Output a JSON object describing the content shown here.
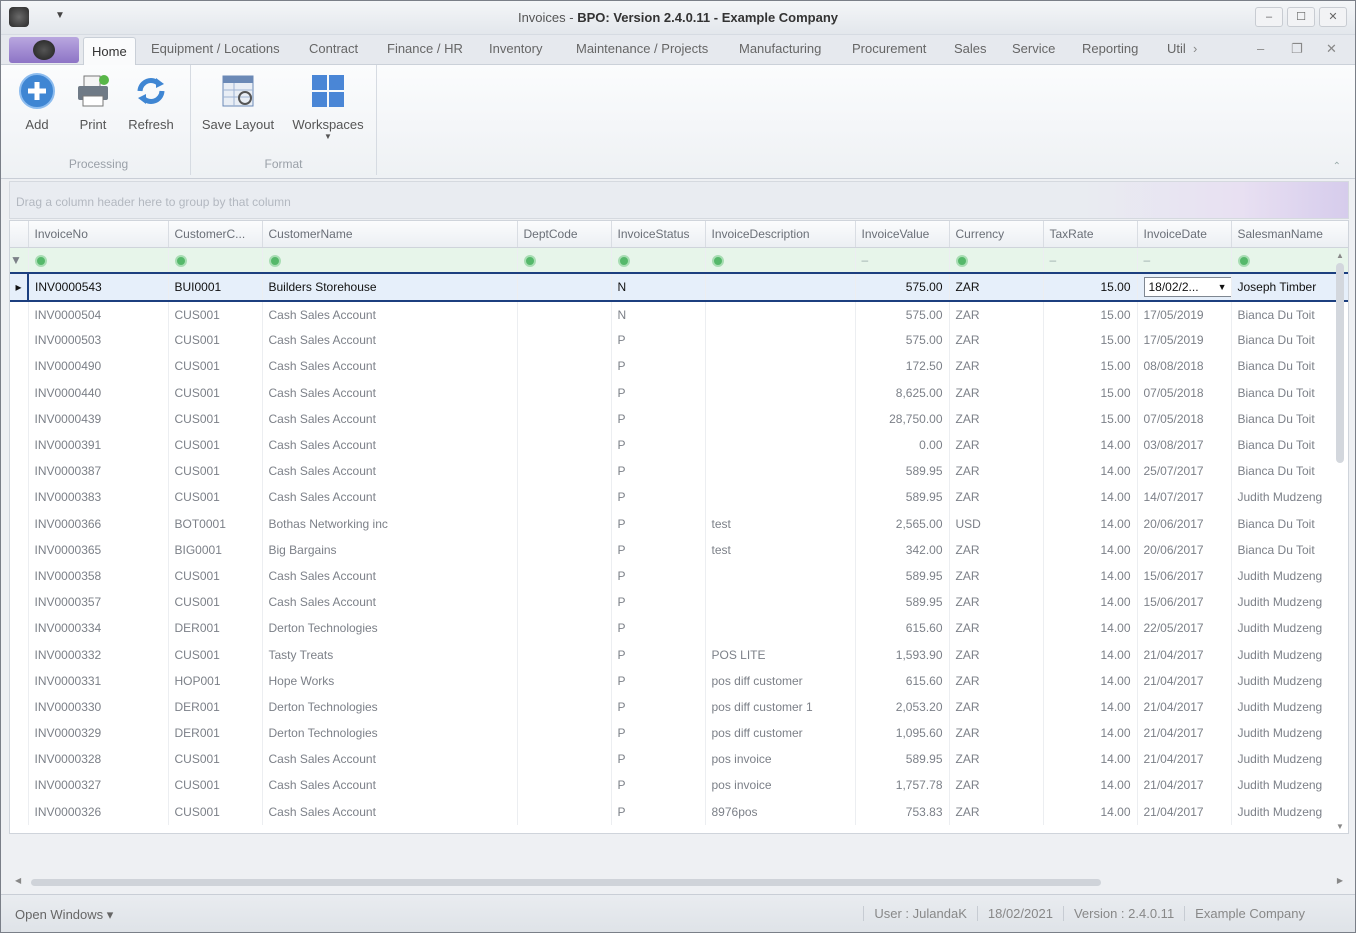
{
  "window": {
    "title_prefix": "Invoices - ",
    "title_bold": "BPO: Version 2.4.0.11 - Example Company",
    "controls": [
      "–",
      "☐",
      "✕"
    ]
  },
  "ribbon_tabs": [
    "Home",
    "Equipment / Locations",
    "Contract",
    "Finance / HR",
    "Inventory",
    "Maintenance / Projects",
    "Manufacturing",
    "Procurement",
    "Sales",
    "Service",
    "Reporting",
    "Util"
  ],
  "ribbon": {
    "processing": {
      "label": "Processing",
      "buttons": [
        "Add",
        "Print",
        "Refresh"
      ]
    },
    "format": {
      "label": "Format",
      "buttons": [
        "Save Layout",
        "Workspaces"
      ]
    }
  },
  "group_panel_hint": "Drag a column header here to group by that column",
  "columns": [
    "InvoiceNo",
    "CustomerC...",
    "CustomerName",
    "DeptCode",
    "InvoiceStatus",
    "InvoiceDescription",
    "InvoiceValue",
    "Currency",
    "TaxRate",
    "InvoiceDate",
    "SalesmanName"
  ],
  "selected_row": [
    "INV0000543",
    "BUI0001",
    "Builders Storehouse",
    "",
    "N",
    "",
    "575.00",
    "ZAR",
    "15.00",
    "18/02/2...",
    "Joseph Timber"
  ],
  "rows": [
    [
      "INV0000504",
      "CUS001",
      "Cash Sales Account",
      "",
      "N",
      "",
      "575.00",
      "ZAR",
      "15.00",
      "17/05/2019",
      "Bianca Du Toit"
    ],
    [
      "INV0000503",
      "CUS001",
      "Cash Sales Account",
      "",
      "P",
      "",
      "575.00",
      "ZAR",
      "15.00",
      "17/05/2019",
      "Bianca Du Toit"
    ],
    [
      "INV0000490",
      "CUS001",
      "Cash Sales Account",
      "",
      "P",
      "",
      "172.50",
      "ZAR",
      "15.00",
      "08/08/2018",
      "Bianca Du Toit"
    ],
    [
      "INV0000440",
      "CUS001",
      "Cash Sales Account",
      "",
      "P",
      "",
      "8,625.00",
      "ZAR",
      "15.00",
      "07/05/2018",
      "Bianca Du Toit"
    ],
    [
      "INV0000439",
      "CUS001",
      "Cash Sales Account",
      "",
      "P",
      "",
      "28,750.00",
      "ZAR",
      "15.00",
      "07/05/2018",
      "Bianca Du Toit"
    ],
    [
      "INV0000391",
      "CUS001",
      "Cash Sales Account",
      "",
      "P",
      "",
      "0.00",
      "ZAR",
      "14.00",
      "03/08/2017",
      "Bianca Du Toit"
    ],
    [
      "INV0000387",
      "CUS001",
      "Cash Sales Account",
      "",
      "P",
      "",
      "589.95",
      "ZAR",
      "14.00",
      "25/07/2017",
      "Bianca Du Toit"
    ],
    [
      "INV0000383",
      "CUS001",
      "Cash Sales Account",
      "",
      "P",
      "",
      "589.95",
      "ZAR",
      "14.00",
      "14/07/2017",
      "Judith Mudzeng"
    ],
    [
      "INV0000366",
      "BOT0001",
      "Bothas Networking inc",
      "",
      "P",
      "test",
      "2,565.00",
      "USD",
      "14.00",
      "20/06/2017",
      "Bianca Du Toit"
    ],
    [
      "INV0000365",
      "BIG0001",
      "Big Bargains",
      "",
      "P",
      "test",
      "342.00",
      "ZAR",
      "14.00",
      "20/06/2017",
      "Bianca Du Toit"
    ],
    [
      "INV0000358",
      "CUS001",
      "Cash Sales Account",
      "",
      "P",
      "",
      "589.95",
      "ZAR",
      "14.00",
      "15/06/2017",
      "Judith Mudzeng"
    ],
    [
      "INV0000357",
      "CUS001",
      "Cash Sales Account",
      "",
      "P",
      "",
      "589.95",
      "ZAR",
      "14.00",
      "15/06/2017",
      "Judith Mudzeng"
    ],
    [
      "INV0000334",
      "DER001",
      "Derton Technologies",
      "",
      "P",
      "",
      "615.60",
      "ZAR",
      "14.00",
      "22/05/2017",
      "Judith Mudzeng"
    ],
    [
      "INV0000332",
      "CUS001",
      "Tasty Treats",
      "",
      "P",
      "POS LITE",
      "1,593.90",
      "ZAR",
      "14.00",
      "21/04/2017",
      "Judith Mudzeng"
    ],
    [
      "INV0000331",
      "HOP001",
      "Hope Works",
      "",
      "P",
      "pos diff customer",
      "615.60",
      "ZAR",
      "14.00",
      "21/04/2017",
      "Judith Mudzeng"
    ],
    [
      "INV0000330",
      "DER001",
      "Derton Technologies",
      "",
      "P",
      "pos diff customer 1",
      "2,053.20",
      "ZAR",
      "14.00",
      "21/04/2017",
      "Judith Mudzeng"
    ],
    [
      "INV0000329",
      "DER001",
      "Derton Technologies",
      "",
      "P",
      "pos diff customer",
      "1,095.60",
      "ZAR",
      "14.00",
      "21/04/2017",
      "Judith Mudzeng"
    ],
    [
      "INV0000328",
      "CUS001",
      "Cash Sales Account",
      "",
      "P",
      "pos invoice",
      "589.95",
      "ZAR",
      "14.00",
      "21/04/2017",
      "Judith Mudzeng"
    ],
    [
      "INV0000327",
      "CUS001",
      "Cash Sales Account",
      "",
      "P",
      "pos invoice",
      "1,757.78",
      "ZAR",
      "14.00",
      "21/04/2017",
      "Judith Mudzeng"
    ],
    [
      "INV0000326",
      "CUS001",
      "Cash Sales Account",
      "",
      "P",
      "8976pos",
      "753.83",
      "ZAR",
      "14.00",
      "21/04/2017",
      "Judith Mudzeng"
    ]
  ],
  "statusbar": {
    "open_windows": "Open Windows ▾",
    "user": "User : JulandaK",
    "date": "18/02/2021",
    "version": "Version : 2.4.0.11",
    "company": "Example Company"
  },
  "colors": {
    "selection_border": "#1c3f7f",
    "filter_row": "#e7f5ea",
    "app_menu": "#8d74c6"
  }
}
